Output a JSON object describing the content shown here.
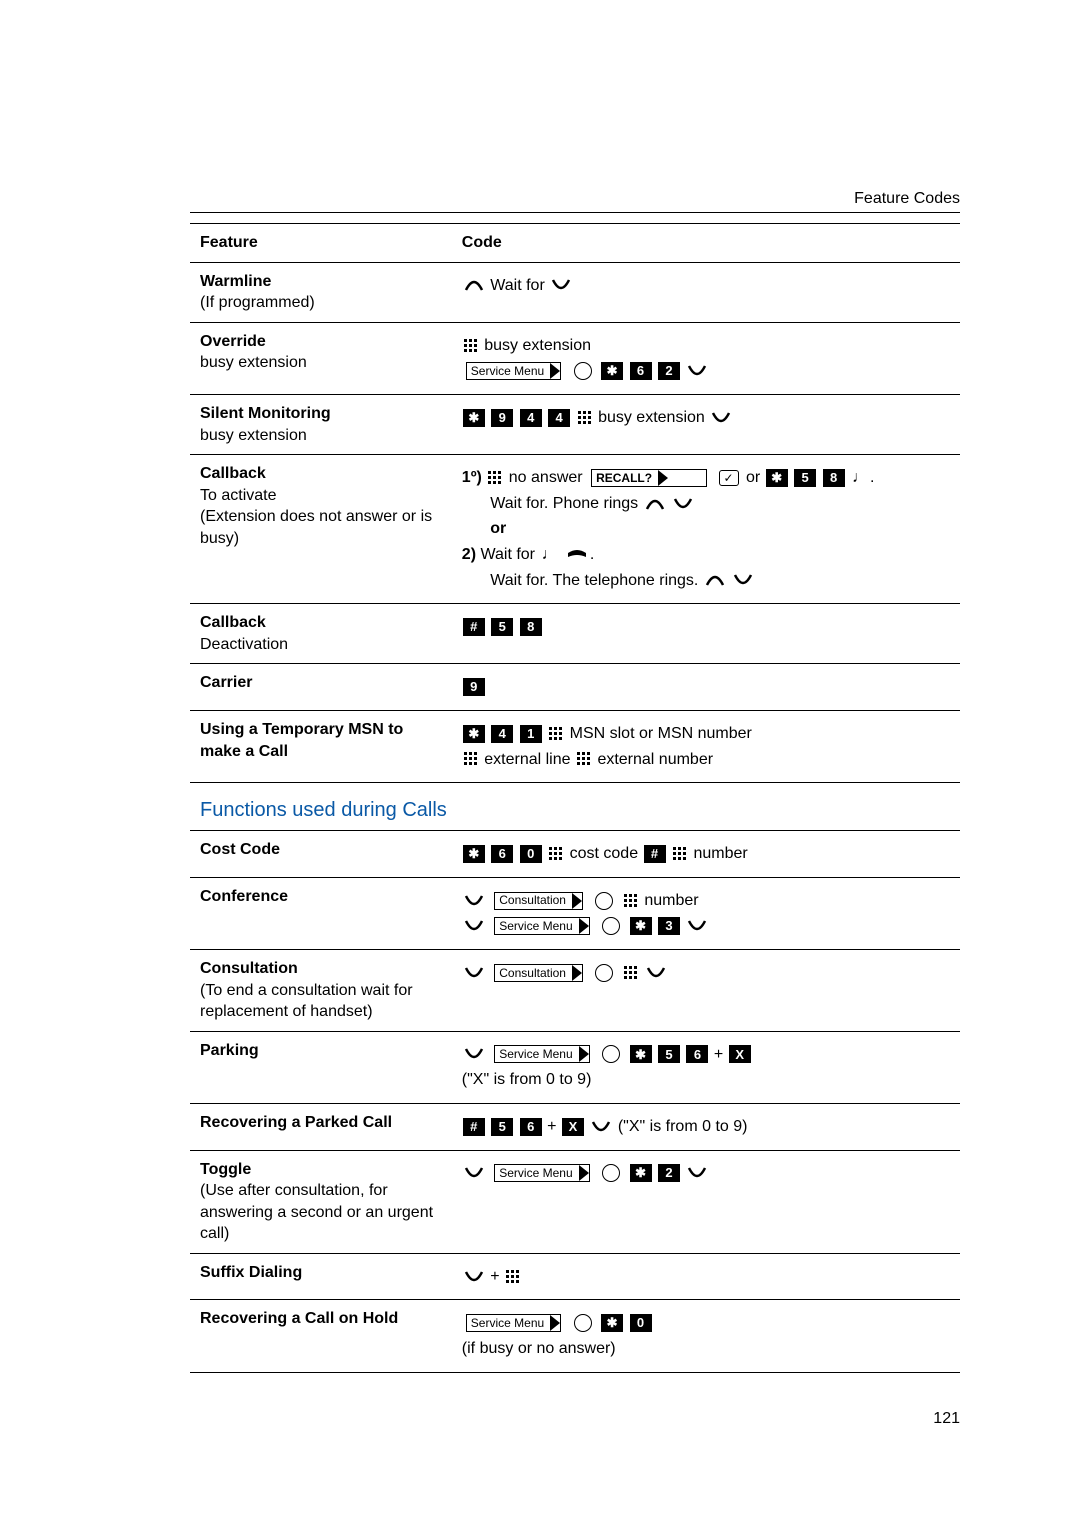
{
  "header": {
    "label": "Feature Codes"
  },
  "columns": {
    "feature": "Feature",
    "code": "Code"
  },
  "section_title": "Functions used during Calls",
  "page_number": "121",
  "rows": {
    "warmline": {
      "title": "Warmline",
      "sub": "(If programmed)",
      "wait_for": "Wait for"
    },
    "override": {
      "title": "Override",
      "sub": "busy extension",
      "busy_ext": "busy  extension",
      "service_menu": "Service Menu",
      "d6": "6",
      "d2": "2"
    },
    "silent": {
      "title": "Silent Monitoring",
      "sub": "busy extension",
      "d9": "9",
      "d4a": "4",
      "d4b": "4",
      "busy_ext": "busy extension"
    },
    "callback_act": {
      "title": "Callback",
      "line2": "To activate",
      "line3": "(Extension does not answer or is busy)",
      "prefix1": "1º)",
      "noanswer": "no answer",
      "recall": "RECALL?",
      "or": "or",
      "d5": "5",
      "d8": "8",
      "wait_phone": "Wait for.  Phone rings",
      "or2": "or",
      "prefix2": "2)",
      "wait_for": "Wait for",
      "wait_tel": "Wait for. The telephone rings."
    },
    "callback_deact": {
      "title": "Callback",
      "sub": "Deactivation",
      "d5": "5",
      "d8": "8"
    },
    "carrier": {
      "title": "Carrier",
      "d9": "9"
    },
    "msn": {
      "title": "Using a Temporary MSN to make a Call",
      "d4": "4",
      "d1": "1",
      "msn_slot": "MSN slot or MSN number",
      "ext_line": "external line",
      "ext_num": "external number"
    },
    "costcode": {
      "title": "Cost Code",
      "d6": "6",
      "d0": "0",
      "cost_code": "cost code",
      "number": "number"
    },
    "conference": {
      "title": "Conference",
      "consultation": "Consultation",
      "number": "number",
      "service_menu": "Service Menu",
      "d3": "3"
    },
    "consultation": {
      "title": "Consultation",
      "sub": "(To end a consultation wait for replacement of handset)",
      "consultation": "Consultation"
    },
    "parking": {
      "title": "Parking",
      "service_menu": "Service Menu",
      "d5": "5",
      "d6": "6",
      "x": "X",
      "note": "(\"X\" is from 0 to 9)"
    },
    "recover_parked": {
      "title": "Recovering a Parked Call",
      "d5": "5",
      "d6": "6",
      "x": "X",
      "note": "(\"X\" is from 0 to 9)"
    },
    "toggle": {
      "title": "Toggle",
      "sub": "(Use after consultation, for answering a second or an urgent call)",
      "service_menu": "Service Menu",
      "d2": "2"
    },
    "suffix": {
      "title": "Suffix Dialing",
      "plus": "+"
    },
    "recover_hold": {
      "title": "Recovering a Call on Hold",
      "service_menu": "Service Menu",
      "d0": "0",
      "note": "(if busy or no answer)"
    }
  }
}
